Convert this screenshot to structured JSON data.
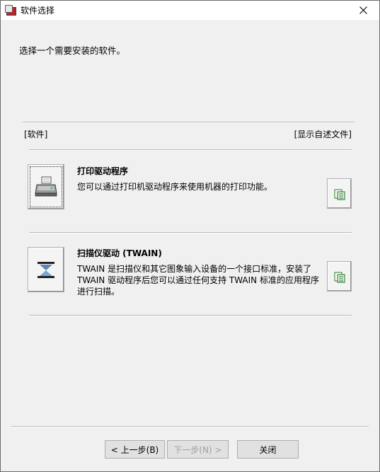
{
  "window": {
    "title": "软件选择",
    "close_label": "close"
  },
  "instruction": "选择一个需要安装的软件。",
  "list_header": {
    "left": "[软件]",
    "right": "[显示自述文件]"
  },
  "items": [
    {
      "title": "打印驱动程序",
      "description": "您可以通过打印机驱动程序来使用机器的打印功能。",
      "icon": "printer-icon"
    },
    {
      "title": "扫描仪驱动 (TWAIN)",
      "description": "TWAIN 是扫描仪和其它图象输入设备的一个接口标准，安装了 TWAIN 驱动程序后您可以通过任何支持 TWAIN 标准的应用程序进行扫描。",
      "icon": "scanner-icon"
    }
  ],
  "buttons": {
    "back": "< 上一步(B)",
    "next": "下一步(N) >",
    "close": "关闭"
  }
}
